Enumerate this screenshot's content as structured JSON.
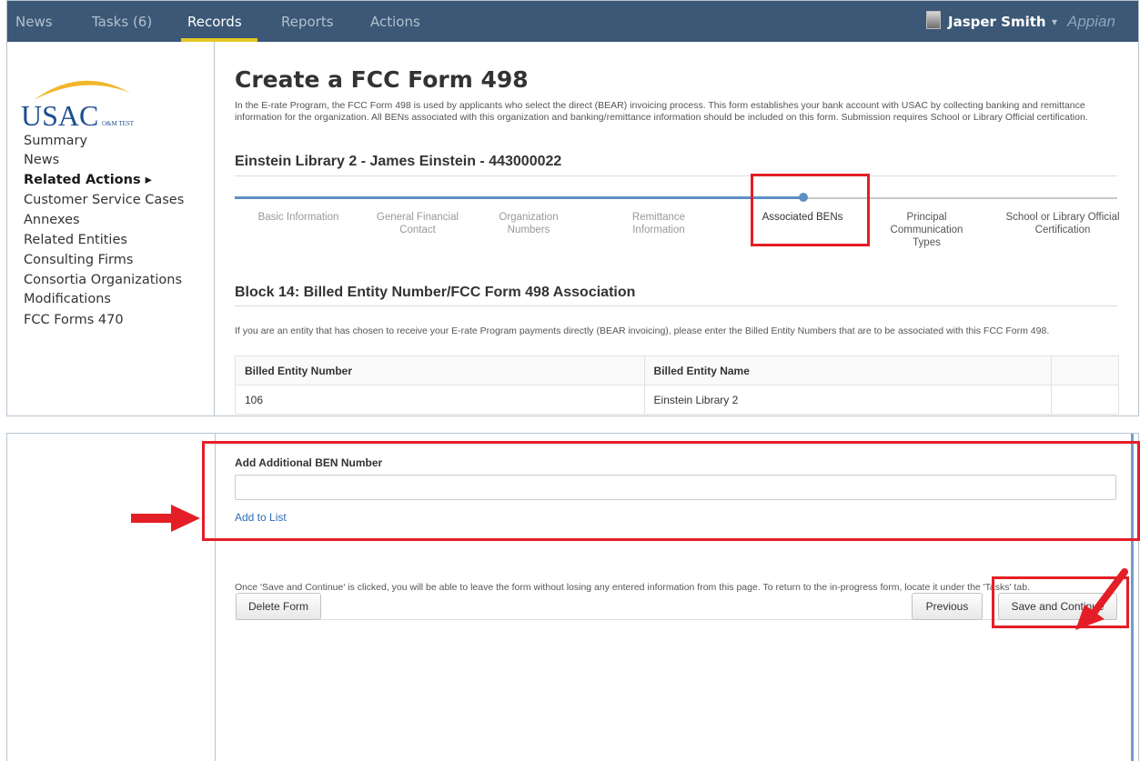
{
  "nav": {
    "items": [
      {
        "label": "News"
      },
      {
        "label": "Tasks (6)"
      },
      {
        "label": "Records"
      },
      {
        "label": "Reports"
      },
      {
        "label": "Actions"
      }
    ],
    "active": "Records",
    "user_name": "Jasper Smith",
    "user_caret": "▾",
    "brand": "Appian"
  },
  "logo": {
    "text": "USAC",
    "subtext": "O&M TEST"
  },
  "sidebar": {
    "items": [
      {
        "label": "Summary"
      },
      {
        "label": "News"
      },
      {
        "label": "Related Actions ▸"
      },
      {
        "label": "Customer Service Cases"
      },
      {
        "label": "Annexes"
      },
      {
        "label": "Related Entities"
      },
      {
        "label": "Consulting Firms"
      },
      {
        "label": "Consortia Organizations"
      },
      {
        "label": "Modifications"
      },
      {
        "label": "FCC Forms 470"
      }
    ]
  },
  "form": {
    "title": "Create a FCC Form 498",
    "intro": "In the E-rate Program, the FCC Form 498 is used by applicants who select the direct (BEAR) invoicing process. This form establishes your bank account with USAC by collecting banking and remittance information for the organization. All BENs associated with this organization and banking/remittance information should be included on this form. Submission requires School or Library Official certification.",
    "entity_title": "Einstein Library 2 - James Einstein - 443000022",
    "steps": [
      {
        "label": "Basic Information"
      },
      {
        "label": "General Financial Contact"
      },
      {
        "label": "Organization Numbers"
      },
      {
        "label": "Remittance Information"
      },
      {
        "label": "Associated BENs"
      },
      {
        "label": "Principal Communication Types"
      },
      {
        "label": "School or Library Official Certification"
      }
    ],
    "current_step": "Associated BENs",
    "block_title": "Block 14: Billed Entity Number/FCC Form 498 Association",
    "block_desc": "If you are an entity that has chosen to receive your E-rate Program payments directly (BEAR invoicing), please enter the Billed Entity Numbers that are to be associated with this FCC Form 498.",
    "table": {
      "headers": [
        "Billed Entity Number",
        "Billed Entity Name"
      ],
      "rows": [
        [
          "106",
          "Einstein Library 2"
        ]
      ]
    }
  },
  "bottom": {
    "add_ben_label": "Add Additional BEN Number",
    "add_ben_value": "",
    "add_to_list": "Add to List",
    "save_note": "Once 'Save and Continue' is clicked, you will be able to leave the form without losing any entered information from this page. To return to the in-progress form, locate it under the 'Tasks' tab.",
    "delete_label": "Delete Form",
    "previous_label": "Previous",
    "save_label": "Save and Continue"
  },
  "colors": {
    "nav_bg": "#3c5876",
    "nav_active_underline": "#e5c826",
    "callout_red": "#e41e26",
    "progress_blue": "#5f8fc3",
    "link_blue": "#2c6db5"
  },
  "icons": {
    "user": "user-avatar-icon",
    "arrow": "red-arrow-icon"
  }
}
